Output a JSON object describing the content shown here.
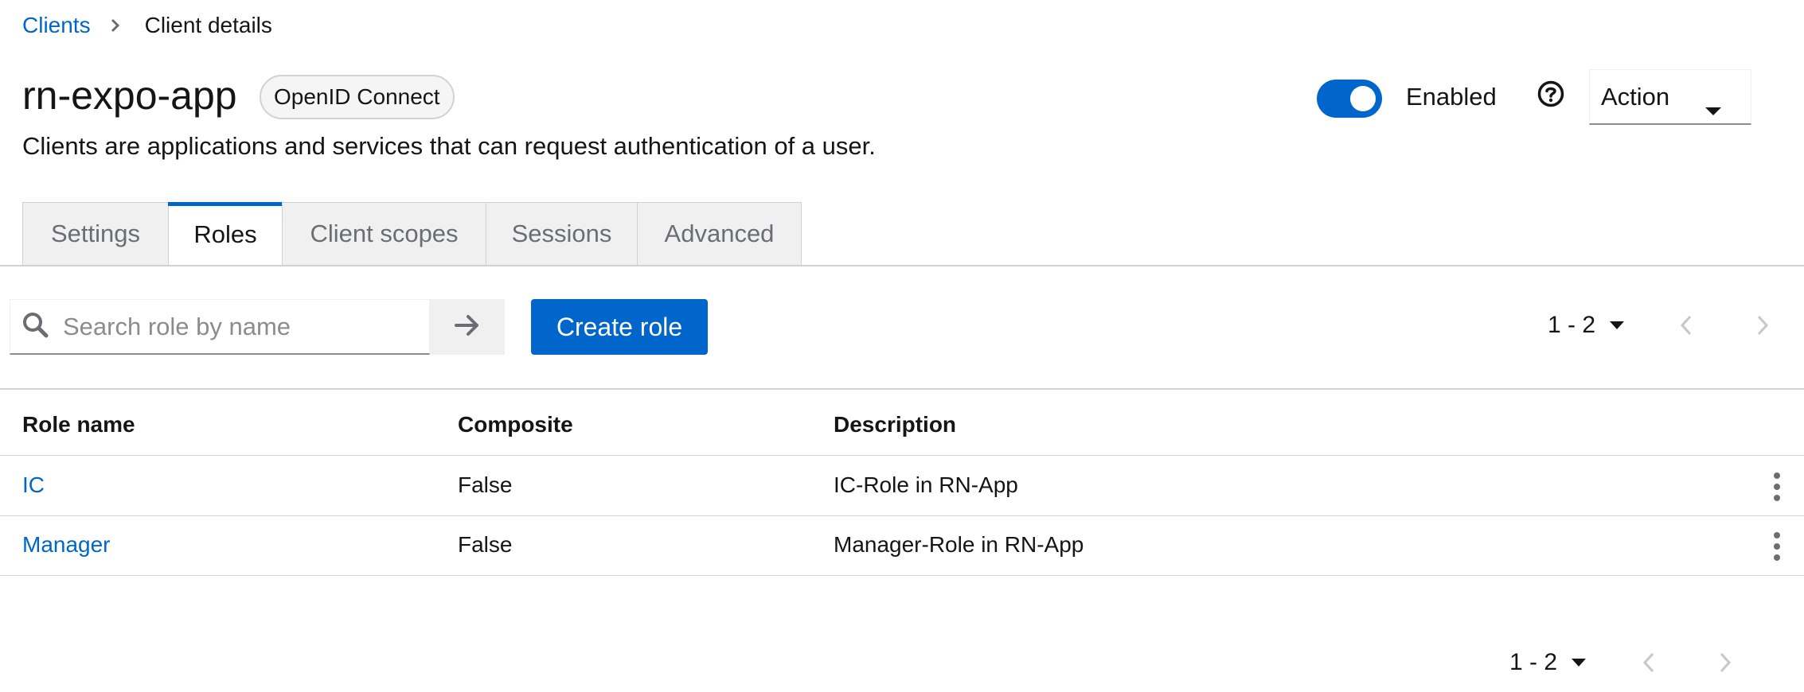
{
  "breadcrumb": {
    "parent": "Clients",
    "current": "Client details"
  },
  "header": {
    "title": "rn-expo-app",
    "protocol_badge": "OpenID Connect",
    "subtitle": "Clients are applications and services that can request authentication of a user.",
    "enabled_label": "Enabled",
    "enabled": true,
    "action_label": "Action"
  },
  "tabs": [
    {
      "label": "Settings",
      "active": false
    },
    {
      "label": "Roles",
      "active": true
    },
    {
      "label": "Client scopes",
      "active": false
    },
    {
      "label": "Sessions",
      "active": false
    },
    {
      "label": "Advanced",
      "active": false
    }
  ],
  "toolbar": {
    "search_placeholder": "Search role by name",
    "search_value": "",
    "create_label": "Create role",
    "pagination_top": "1 - 2"
  },
  "table": {
    "columns": [
      "Role name",
      "Composite",
      "Description"
    ],
    "rows": [
      {
        "name": "IC",
        "composite": "False",
        "description": "IC-Role in RN-App"
      },
      {
        "name": "Manager",
        "composite": "False",
        "description": "Manager-Role in RN-App"
      }
    ]
  },
  "footer": {
    "pagination_bottom": "1 - 2"
  },
  "colors": {
    "accent": "#0066cc",
    "border": "#d2d2d2",
    "tab_bg": "#f0f0f0",
    "muted": "#6a6e73"
  },
  "icons": [
    "chevron-right-icon",
    "help-icon",
    "caret-down-icon",
    "search-icon",
    "arrow-right-icon",
    "angle-left-icon",
    "angle-right-icon",
    "kebab-icon"
  ]
}
